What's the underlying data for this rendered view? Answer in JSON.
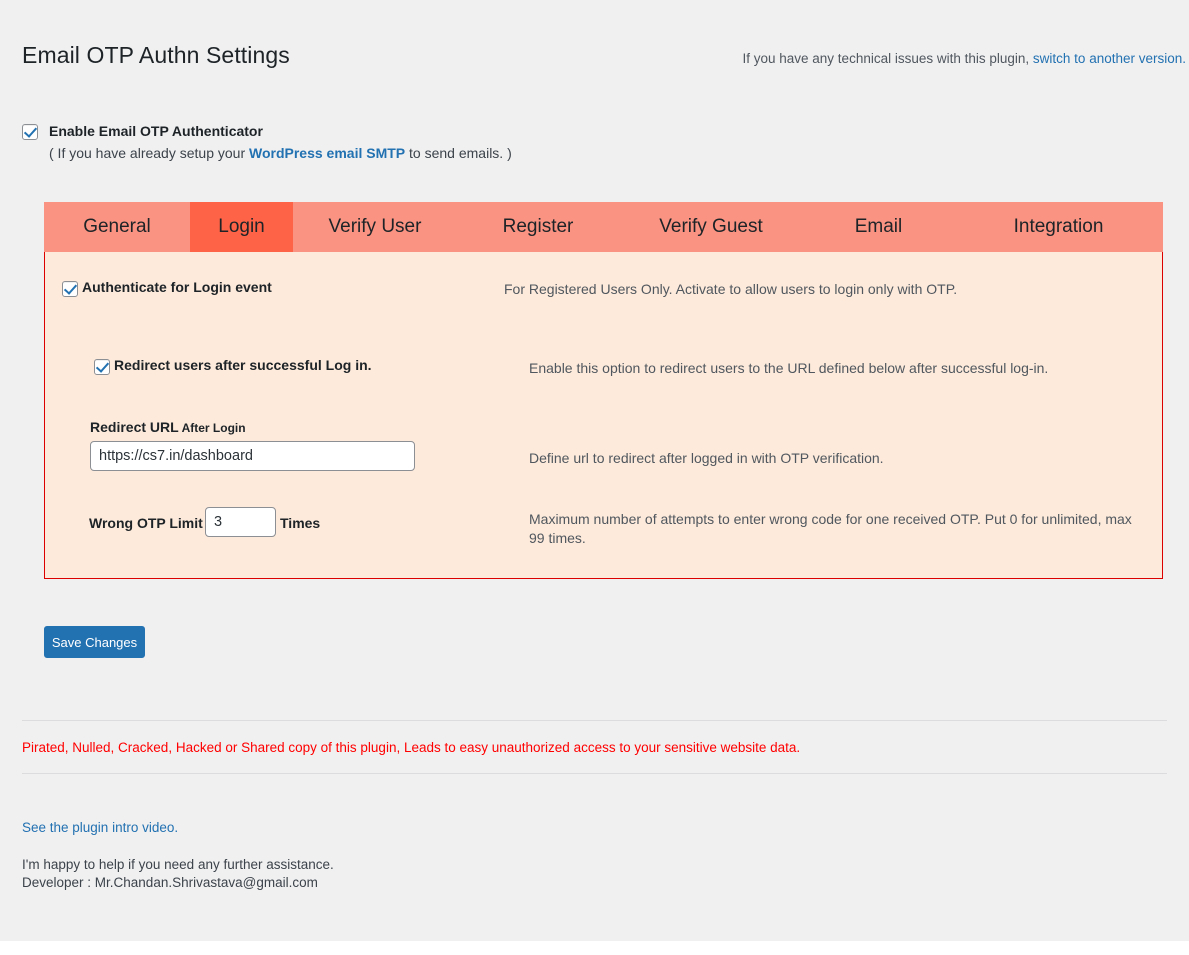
{
  "header": {
    "title": "Email OTP Authn Settings",
    "tech_note_prefix": "If you have any technical issues with this plugin, ",
    "tech_note_link": "switch to another version."
  },
  "enable": {
    "label": "Enable Email OTP Authenticator",
    "checked": true,
    "sub_prefix": "( If you have already setup your ",
    "sub_link": "WordPress email SMTP",
    "sub_suffix": " to send emails. )"
  },
  "tabs": {
    "active": "Login",
    "items": [
      {
        "label": "General"
      },
      {
        "label": "Login"
      },
      {
        "label": "Verify User"
      },
      {
        "label": "Register"
      },
      {
        "label": "Verify Guest"
      },
      {
        "label": "Email"
      },
      {
        "label": "Integration"
      }
    ]
  },
  "panel": {
    "authenticate": {
      "label": "Authenticate for Login event",
      "checked": true,
      "description": "For Registered Users Only. Activate to allow users to login only with OTP."
    },
    "redirect": {
      "label": "Redirect users after successful Log in.",
      "checked": true,
      "description": "Enable this option to redirect users to the URL defined below after successful log-in."
    },
    "redirect_url": {
      "label_main": "Redirect URL",
      "label_sub": " After Login",
      "value": "https://cs7.in/dashboard",
      "placeholder": "",
      "description": "Define url to redirect after logged in with OTP verification."
    },
    "wrong_otp_limit": {
      "label": "Wrong OTP Limit",
      "value": "3",
      "unit": "Times",
      "description": "Maximum number of attempts to enter wrong code for one received OTP. Put 0 for unlimited, max 99 times."
    }
  },
  "actions": {
    "save_label": "Save Changes"
  },
  "warning": {
    "text": "Pirated, Nulled, Cracked, Hacked or Shared copy of this plugin, Leads to easy unauthorized access to your sensitive website data."
  },
  "footer": {
    "video_link": "See the plugin intro video.",
    "help_text": "I'm happy to help if you need any further assistance.",
    "developer_text": "Developer : Mr.Chandan.Shrivastava@gmail.com"
  },
  "colors": {
    "tabbar": "#fa9382",
    "tab_active": "#ff6347",
    "panel_bg": "#fdeadb",
    "panel_border": "#dd0000",
    "accent_blue": "#2271b1",
    "warning_red": "#ff0000"
  }
}
